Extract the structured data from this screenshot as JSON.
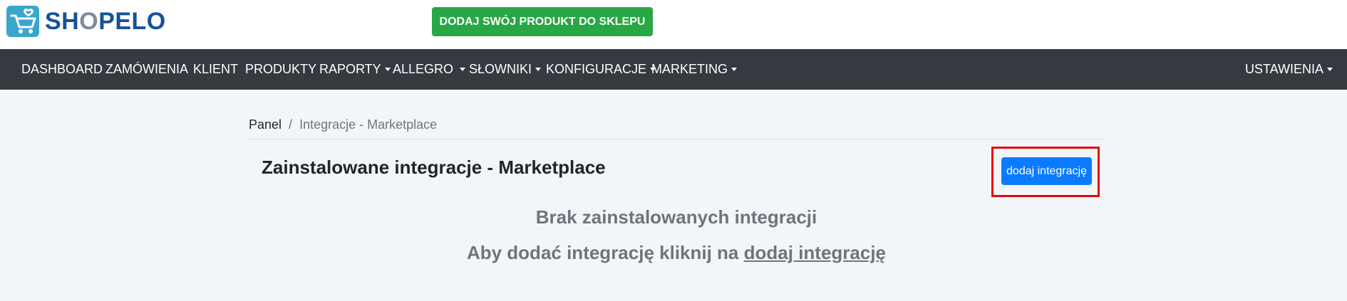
{
  "header": {
    "logo_text_a": "SH",
    "logo_text_o": "O",
    "logo_text_b": "PELO",
    "cta_label": "DODAJ SWÓJ PRODUKT DO SKLEPU"
  },
  "nav": {
    "items": [
      {
        "label": "DASHBOARD"
      },
      {
        "label": "ZAMÓWIENIA"
      },
      {
        "label": "KLIENT"
      },
      {
        "label": "PRODUKTY"
      },
      {
        "label": "RAPORTY"
      },
      {
        "label": "ALLEGRO"
      },
      {
        "label": "SŁOWNIKI"
      },
      {
        "label": "KONFIGURACJE"
      },
      {
        "label": "MARKETING"
      }
    ],
    "settings_label": "USTAWIENIA"
  },
  "breadcrumb": {
    "root": "Panel",
    "separator": "/",
    "current": "Integracje - Marketplace"
  },
  "main": {
    "title": "Zainstalowane integracje - Marketplace",
    "add_button_label": "dodaj integrację",
    "empty_title": "Brak zainstalowanych integracji",
    "empty_hint_prefix": "Aby dodać integrację kliknij na",
    "empty_hint_link": "dodaj integrację"
  },
  "colors": {
    "navbar_bg": "#343a40",
    "cta_bg": "#28a745",
    "button_primary": "#0a7bff",
    "highlight_border": "#e50914",
    "page_bg": "#f3f6f9"
  }
}
